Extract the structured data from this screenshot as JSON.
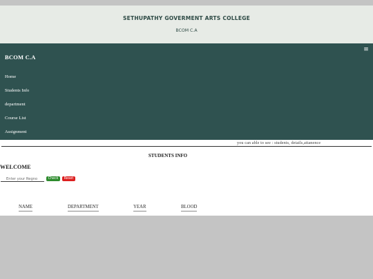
{
  "header": {
    "college_name": "SETHUPATHY GOVERMENT ARTS COLLEGE",
    "subtitle": "BCOM C.A"
  },
  "nav": {
    "brand": "BCOM C.A",
    "menu_icon": "hamburger-menu-icon",
    "menu_glyph": "≡",
    "items": [
      {
        "label": "Home"
      },
      {
        "label": "Students Info"
      },
      {
        "label": "department"
      },
      {
        "label": "Course List"
      },
      {
        "label": "Assignment"
      }
    ]
  },
  "content": {
    "marquee_text": "you can able to see : students, details,attanence",
    "section_title": "STUDENTS INFO",
    "welcome": "WELCOME",
    "register_input": {
      "placeholder": "Enter your Regno",
      "value": ""
    },
    "buttons": {
      "check": "Check",
      "reset": "Reset"
    },
    "table": {
      "columns": [
        "NAME",
        "DEPARTMENT",
        "YEAR",
        "BLOOD"
      ],
      "rows": []
    }
  },
  "colors": {
    "nav_background": "#2f5250",
    "header_background": "#e7ebe6",
    "check_button": "#2e8b2e",
    "reset_button": "#dc1f1f",
    "page_background": "#c4c4c4"
  }
}
